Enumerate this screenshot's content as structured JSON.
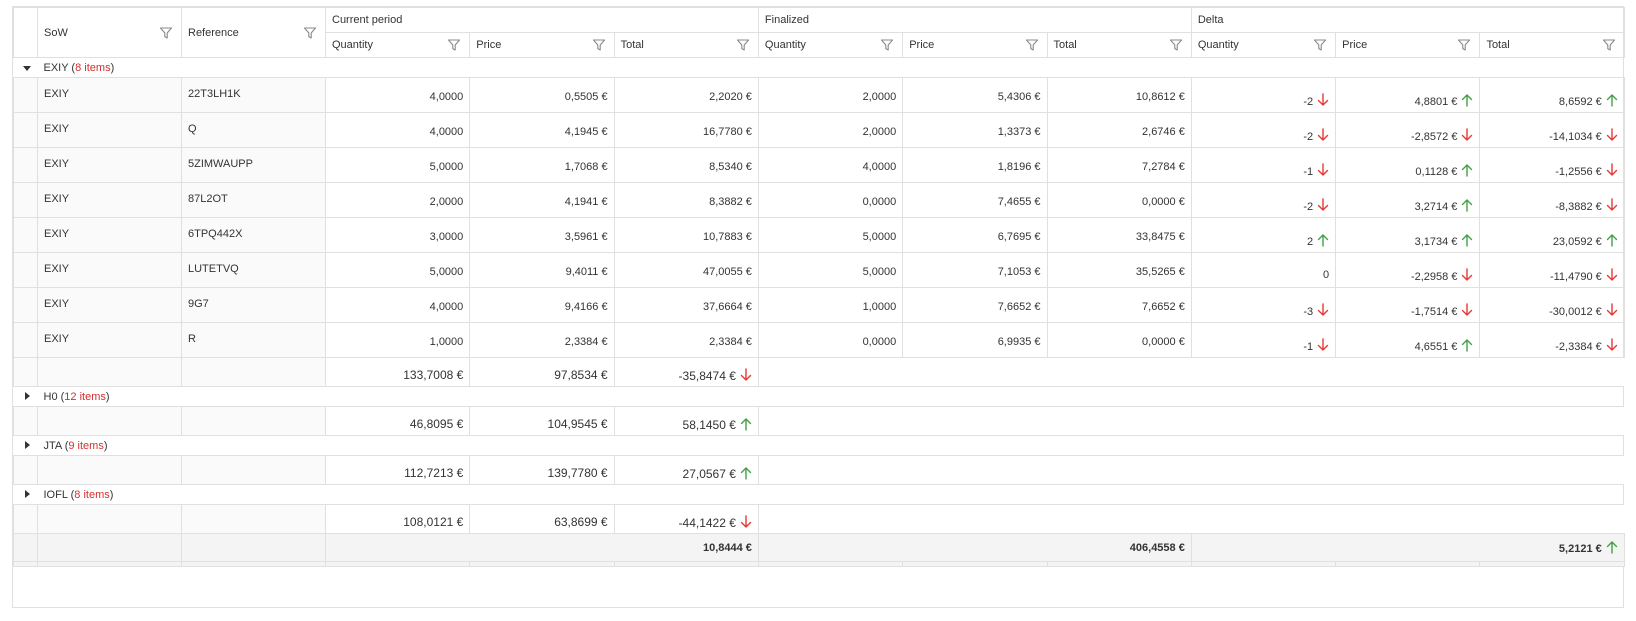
{
  "headers": {
    "sow": "SoW",
    "reference": "Reference",
    "groups": [
      "Current period",
      "Finalized",
      "Delta"
    ],
    "sub": [
      "Quantity",
      "Price",
      "Total"
    ]
  },
  "groups": [
    {
      "name": "EXIY",
      "count_label": "8 items",
      "expanded": true,
      "rows": [
        {
          "sow": "EXIY",
          "ref": "22T3LH1K",
          "cq": "4,0000",
          "cp": "0,5505 €",
          "ct": "2,2020 €",
          "fq": "2,0000",
          "fp": "5,4306 €",
          "ft": "10,8612 €",
          "dq": "-2",
          "dq_dir": "down",
          "dp": "4,8801 €",
          "dp_dir": "up",
          "dt": "8,6592 €",
          "dt_dir": "up"
        },
        {
          "sow": "EXIY",
          "ref": "Q",
          "cq": "4,0000",
          "cp": "4,1945 €",
          "ct": "16,7780 €",
          "fq": "2,0000",
          "fp": "1,3373 €",
          "ft": "2,6746 €",
          "dq": "-2",
          "dq_dir": "down",
          "dp": "-2,8572 €",
          "dp_dir": "down",
          "dt": "-14,1034 €",
          "dt_dir": "down"
        },
        {
          "sow": "EXIY",
          "ref": "5ZIMWAUPP",
          "cq": "5,0000",
          "cp": "1,7068 €",
          "ct": "8,5340 €",
          "fq": "4,0000",
          "fp": "1,8196 €",
          "ft": "7,2784 €",
          "dq": "-1",
          "dq_dir": "down",
          "dp": "0,1128 €",
          "dp_dir": "up",
          "dt": "-1,2556 €",
          "dt_dir": "down"
        },
        {
          "sow": "EXIY",
          "ref": "87L2OT",
          "cq": "2,0000",
          "cp": "4,1941 €",
          "ct": "8,3882 €",
          "fq": "0,0000",
          "fp": "7,4655 €",
          "ft": "0,0000 €",
          "dq": "-2",
          "dq_dir": "down",
          "dp": "3,2714 €",
          "dp_dir": "up",
          "dt": "-8,3882 €",
          "dt_dir": "down"
        },
        {
          "sow": "EXIY",
          "ref": "6TPQ442X",
          "cq": "3,0000",
          "cp": "3,5961 €",
          "ct": "10,7883 €",
          "fq": "5,0000",
          "fp": "6,7695 €",
          "ft": "33,8475 €",
          "dq": "2",
          "dq_dir": "up",
          "dp": "3,1734 €",
          "dp_dir": "up",
          "dt": "23,0592 €",
          "dt_dir": "up"
        },
        {
          "sow": "EXIY",
          "ref": "LUTETVQ",
          "cq": "5,0000",
          "cp": "9,4011 €",
          "ct": "47,0055 €",
          "fq": "5,0000",
          "fp": "7,1053 €",
          "ft": "35,5265 €",
          "dq": "0",
          "dq_dir": "none",
          "dp": "-2,2958 €",
          "dp_dir": "down",
          "dt": "-11,4790 €",
          "dt_dir": "down"
        },
        {
          "sow": "EXIY",
          "ref": "9G7",
          "cq": "4,0000",
          "cp": "9,4166 €",
          "ct": "37,6664 €",
          "fq": "1,0000",
          "fp": "7,6652 €",
          "ft": "7,6652 €",
          "dq": "-3",
          "dq_dir": "down",
          "dp": "-1,7514 €",
          "dp_dir": "down",
          "dt": "-30,0012 €",
          "dt_dir": "down"
        },
        {
          "sow": "EXIY",
          "ref": "R",
          "cq": "1,0000",
          "cp": "2,3384 €",
          "ct": "2,3384 €",
          "fq": "0,0000",
          "fp": "6,9935 €",
          "ft": "0,0000 €",
          "dq": "-1",
          "dq_dir": "down",
          "dp": "4,6551 €",
          "dp_dir": "up",
          "dt": "-2,3384 €",
          "dt_dir": "down"
        }
      ],
      "summary": {
        "a": "133,7008 €",
        "b": "97,8534 €",
        "c": "-35,8474 €",
        "c_dir": "down"
      }
    },
    {
      "name": "H0",
      "count_label": "12 items",
      "expanded": false,
      "rows": [],
      "summary": {
        "a": "46,8095 €",
        "b": "104,9545 €",
        "c": "58,1450 €",
        "c_dir": "up"
      }
    },
    {
      "name": "JTA",
      "count_label": "9 items",
      "expanded": false,
      "rows": [],
      "summary": {
        "a": "112,7213 €",
        "b": "139,7780 €",
        "c": "27,0567 €",
        "c_dir": "up"
      }
    },
    {
      "name": "IOFL",
      "count_label": "8 items",
      "expanded": false,
      "rows": [],
      "summary": {
        "a": "108,0121 €",
        "b": "63,8699 €",
        "c": "-44,1422 €",
        "c_dir": "down"
      }
    }
  ],
  "totals": {
    "current_total": "10,8444 €",
    "finalized_total": "406,4558 €",
    "delta_total": "5,2121 €",
    "delta_total_dir": "up"
  },
  "colors": {
    "up": "#43a047",
    "down": "#e53935",
    "count": "#d32f2f",
    "border": "#e0e0e0"
  }
}
